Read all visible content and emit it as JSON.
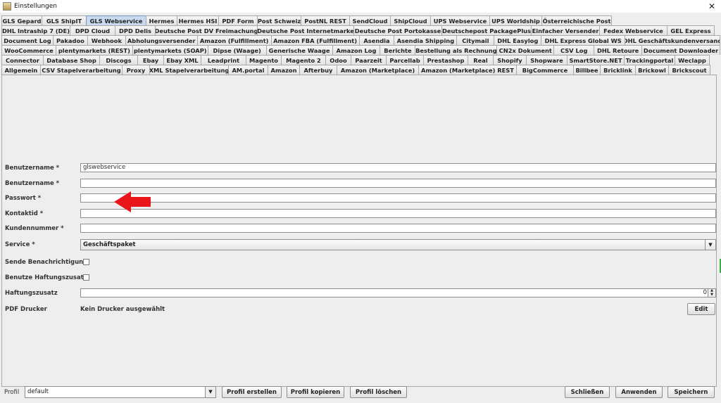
{
  "window": {
    "title": "Einstellungen",
    "close": "✕"
  },
  "tabs": {
    "row1": [
      "GLS Gepard",
      "GLS ShipIT",
      "GLS Webservice",
      "Hermes",
      "Hermes HSI",
      "PDF Form",
      "Post Schweiz",
      "PostNL REST",
      "SendCloud",
      "ShipCloud",
      "UPS Webservice",
      "UPS Worldship",
      "Österreichische Post"
    ],
    "row2": [
      "DHL Intraship 7 (DE)",
      "DPD Cloud",
      "DPD Delis",
      "Deutsche Post DV Freimachung",
      "Deutsche Post Internetmarke",
      "Deutsche Post Portokasse",
      "Deutschepost PackagePlus",
      "Einfacher Versender",
      "Fedex Webservice",
      "GEL Express"
    ],
    "row3": [
      "Document Log",
      "Pakadoo",
      "Webhook",
      "Abholungsversender",
      "Amazon (Fulfillment)",
      "Amazon FBA (Fulfillment)",
      "Asendia",
      "Asendia Shipping",
      "Citymail",
      "DHL Easylog",
      "DHL Express Global WS",
      "DHL Geschäftskundenversand"
    ],
    "row4": [
      "WooCommerce",
      "plentymarkets (REST)",
      "plentymarkets (SOAP)",
      "Dipse (Waage)",
      "Generische Waage",
      "Amazon Log",
      "Berichte",
      "Bestellung als Rechnung",
      "CN2x Dokument",
      "CSV Log",
      "DHL Retoure",
      "Document Downloader"
    ],
    "row5": [
      "Connector",
      "Database Shop",
      "Discogs",
      "Ebay",
      "Ebay XML",
      "Leadprint",
      "Magento",
      "Magento 2",
      "Odoo",
      "Paarzeit",
      "Parcellab",
      "Prestashop",
      "Real",
      "Shopify",
      "Shopware",
      "SmartStore.NET",
      "Trackingportal",
      "Weclapp"
    ],
    "row6": [
      "Allgemein",
      "CSV Stapelverarbeitung",
      "Proxy",
      "XML Stapelverarbeitung",
      "AM.portal",
      "Amazon",
      "Afterbuy",
      "Amazon (Marketplace)",
      "Amazon (Marketplace) REST",
      "BigCommerce",
      "Billbee",
      "Bricklink",
      "Brickowl",
      "Brickscout"
    ],
    "active": "GLS Webservice"
  },
  "form": {
    "benutzername1": {
      "label": "Benutzername *",
      "value": "glswebservice"
    },
    "benutzername2": {
      "label": "Benutzername *",
      "value": ""
    },
    "passwort": {
      "label": "Passwort *",
      "value": ""
    },
    "kontaktid": {
      "label": "Kontaktid *",
      "value": ""
    },
    "kundennummer": {
      "label": "Kundennummer *",
      "value": ""
    },
    "service": {
      "label": "Service *",
      "value": "Geschäftspaket"
    },
    "sende": {
      "label": "Sende Benachrichtigung"
    },
    "haftung": {
      "label": "Benutze Haftungszusatz"
    },
    "haftungszusatz": {
      "label": "Haftungszusatz",
      "value": "0"
    },
    "pdf": {
      "label": "PDF Drucker",
      "value": "Kein Drucker ausgewählt",
      "edit": "Edit"
    }
  },
  "bottom": {
    "profil_label": "Profil",
    "profil_value": "default",
    "erstellen": "Profil erstellen",
    "kopieren": "Profil kopieren",
    "loeschen": "Profil löschen",
    "schliessen": "Schließen",
    "anwenden": "Anwenden",
    "speichern": "Speichern"
  },
  "colors": {
    "arrow": "#e8161b",
    "active_tab": "#c9daf0"
  }
}
